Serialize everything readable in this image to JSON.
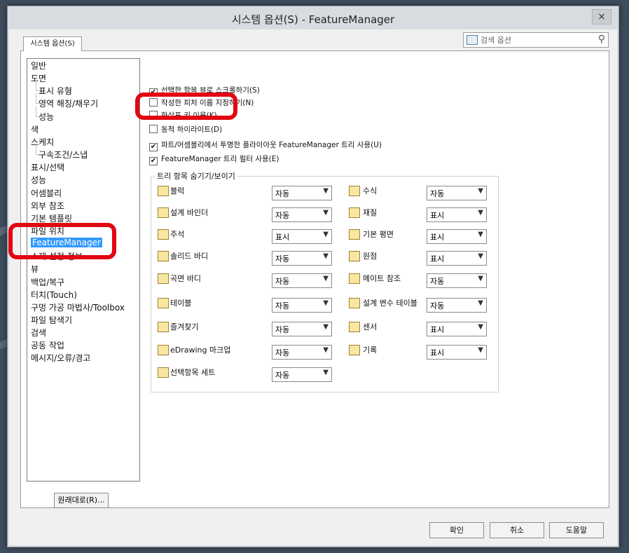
{
  "window": {
    "title": "시스템 옵션(S) - FeatureManager",
    "close": "×"
  },
  "tab": {
    "label": "시스템 옵션(S)"
  },
  "search": {
    "placeholder": "검색 옵션",
    "icon_name": "magnifier-icon"
  },
  "tree": {
    "items": [
      {
        "label": "일반",
        "level": 0
      },
      {
        "label": "도면",
        "level": 0
      },
      {
        "label": "표시 유형",
        "level": 1
      },
      {
        "label": "영역 해칭/채우기",
        "level": 1
      },
      {
        "label": "성능",
        "level": 1
      },
      {
        "label": "색",
        "level": 0
      },
      {
        "label": "스케치",
        "level": 0
      },
      {
        "label": "구속조건/스냅",
        "level": 1
      },
      {
        "label": "표시/선택",
        "level": 0
      },
      {
        "label": "성능",
        "level": 0
      },
      {
        "label": "어셈블리",
        "level": 0
      },
      {
        "label": "외부 참조",
        "level": 0
      },
      {
        "label": "기본 템플릿",
        "level": 0
      },
      {
        "label": "파일 위치",
        "level": 0
      },
      {
        "label": "FeatureManager",
        "level": 0,
        "selected": true
      },
      {
        "label": "소재 설정 정보",
        "level": 0
      },
      {
        "label": "뷰",
        "level": 0
      },
      {
        "label": "백업/복구",
        "level": 0
      },
      {
        "label": "터치(Touch)",
        "level": 0
      },
      {
        "label": "구멍 가공 마법사/Toolbox",
        "level": 0
      },
      {
        "label": "파일 탐색기",
        "level": 0
      },
      {
        "label": "검색",
        "level": 0
      },
      {
        "label": "공동 작업",
        "level": 0
      },
      {
        "label": "메시지/오류/경고",
        "level": 0
      }
    ],
    "restore_button": "원래대로(R)..."
  },
  "options": [
    {
      "label": "선택한 항목 뷰로 스크롤하기(S)",
      "checked": true
    },
    {
      "label": "작성한 피처 이름 지정하기(N)",
      "checked": false
    },
    {
      "label": "화살표 키 이용(K)",
      "checked": false
    },
    {
      "label": "동적 하이라이트(D)",
      "checked": false
    },
    {
      "label": "파트/어셈블리에서 투명한 플라이아웃 FeatureManager 트리 사용(U)",
      "checked": true
    },
    {
      "label": "FeatureManager 트리 필터 사용(E)",
      "checked": true
    }
  ],
  "group": {
    "title": "트리 항목 숨기기/보이기",
    "left": [
      {
        "label": "블럭",
        "value": "자동",
        "icon": "block-icon"
      },
      {
        "label": "설계 바인더",
        "value": "자동",
        "icon": "design-binder-icon"
      },
      {
        "label": "주석",
        "value": "표시",
        "icon": "annotation-icon"
      },
      {
        "label": "솔리드 바디",
        "value": "자동",
        "icon": "solid-body-icon"
      },
      {
        "label": "곡면 바디",
        "value": "자동",
        "icon": "surface-body-icon"
      },
      {
        "label": "테이블",
        "value": "자동",
        "icon": "table-icon"
      },
      {
        "label": "즐겨찾기",
        "value": "자동",
        "icon": "favorites-icon"
      },
      {
        "label": "eDrawing 마크업",
        "value": "자동",
        "icon": "edrawing-markup-icon"
      },
      {
        "label": "선택항목 세트",
        "value": "자동",
        "icon": "selection-set-icon"
      }
    ],
    "right": [
      {
        "label": "수식",
        "value": "자동",
        "icon": "equation-icon"
      },
      {
        "label": "재질",
        "value": "표시",
        "icon": "material-icon"
      },
      {
        "label": "기본 평면",
        "value": "표시",
        "icon": "plane-icon"
      },
      {
        "label": "원점",
        "value": "표시",
        "icon": "origin-icon"
      },
      {
        "label": "메이트 참조",
        "value": "자동",
        "icon": "mate-reference-icon"
      },
      {
        "label": "설계 변수 테이블",
        "value": "자동",
        "icon": "design-table-icon"
      },
      {
        "label": "센서",
        "value": "표시",
        "icon": "sensor-icon"
      },
      {
        "label": "기록",
        "value": "표시",
        "icon": "history-icon"
      }
    ]
  },
  "buttons": {
    "ok": "확인",
    "cancel": "취소",
    "help": "도움말"
  },
  "colors": {
    "highlight": "#e20613",
    "selection": "#3399ff"
  }
}
